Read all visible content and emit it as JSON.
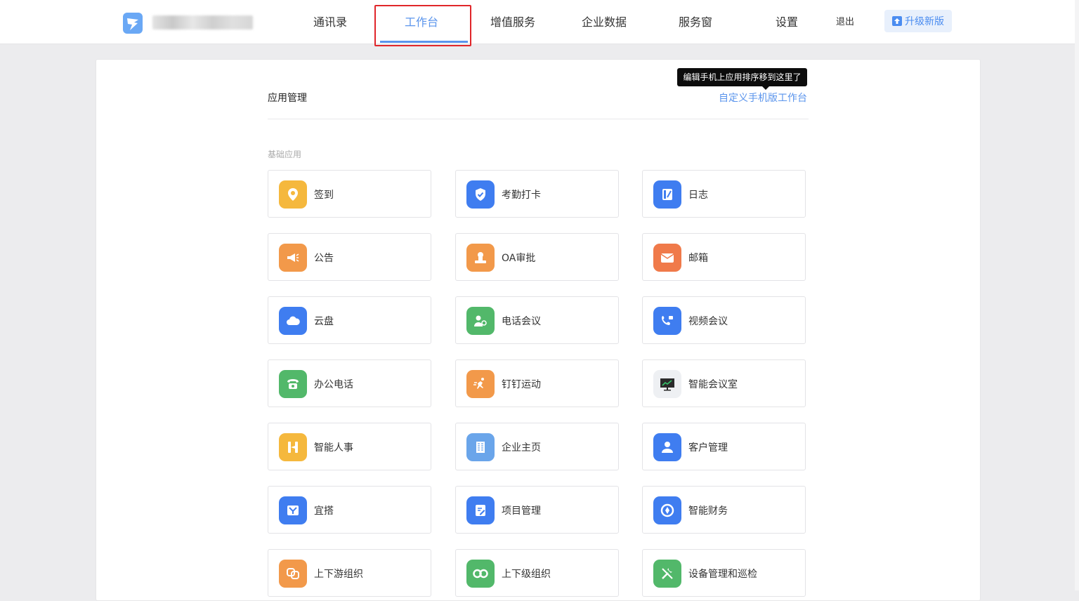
{
  "nav": {
    "items": [
      {
        "label": "通讯录"
      },
      {
        "label": "工作台",
        "active": true
      },
      {
        "label": "增值服务"
      },
      {
        "label": "企业数据"
      },
      {
        "label": "服务窗"
      },
      {
        "label": "设置"
      },
      {
        "label": "退出"
      }
    ],
    "upgrade_label": "升级新版",
    "active_color": "#5a94ec",
    "highlight_color": "#e0262a"
  },
  "main": {
    "section_title": "应用管理",
    "custom_link": "自定义手机版工作台",
    "tooltip": "编辑手机上应用排序移到这里了",
    "category": "基础应用",
    "apps": [
      {
        "label": "签到",
        "icon": "location-pin-icon",
        "color": "#f5b83d"
      },
      {
        "label": "考勤打卡",
        "icon": "shield-check-icon",
        "color": "#3f7df0"
      },
      {
        "label": "日志",
        "icon": "journal-icon",
        "color": "#3f7df0"
      },
      {
        "label": "公告",
        "icon": "megaphone-icon",
        "color": "#f2994a"
      },
      {
        "label": "OA审批",
        "icon": "stamp-icon",
        "color": "#f2994a"
      },
      {
        "label": "邮箱",
        "icon": "envelope-icon",
        "color": "#f07a4a"
      },
      {
        "label": "云盘",
        "icon": "cloud-icon",
        "color": "#3f7df0"
      },
      {
        "label": "电话会议",
        "icon": "phone-conference-icon",
        "color": "#52b86a"
      },
      {
        "label": "视频会议",
        "icon": "video-call-icon",
        "color": "#3f7df0"
      },
      {
        "label": "办公电话",
        "icon": "telephone-icon",
        "color": "#52b86a"
      },
      {
        "label": "钉钉运动",
        "icon": "running-icon",
        "color": "#f2994a"
      },
      {
        "label": "智能会议室",
        "icon": "projector-icon",
        "color": "#eef0f3"
      },
      {
        "label": "智能人事",
        "icon": "hr-icon",
        "color": "#f5b83d"
      },
      {
        "label": "企业主页",
        "icon": "building-icon",
        "color": "#6aa5ea"
      },
      {
        "label": "客户管理",
        "icon": "customer-icon",
        "color": "#3f7df0"
      },
      {
        "label": "宜搭",
        "icon": "yida-icon",
        "color": "#3f7df0"
      },
      {
        "label": "项目管理",
        "icon": "task-edit-icon",
        "color": "#3f7df0"
      },
      {
        "label": "智能财务",
        "icon": "finance-icon",
        "color": "#3f7df0"
      },
      {
        "label": "上下游组织",
        "icon": "link-icon",
        "color": "#f2994a"
      },
      {
        "label": "上下级组织",
        "icon": "infinity-icon",
        "color": "#52b86a"
      },
      {
        "label": "设备管理和巡检",
        "icon": "tools-icon",
        "color": "#52b86a"
      }
    ]
  }
}
